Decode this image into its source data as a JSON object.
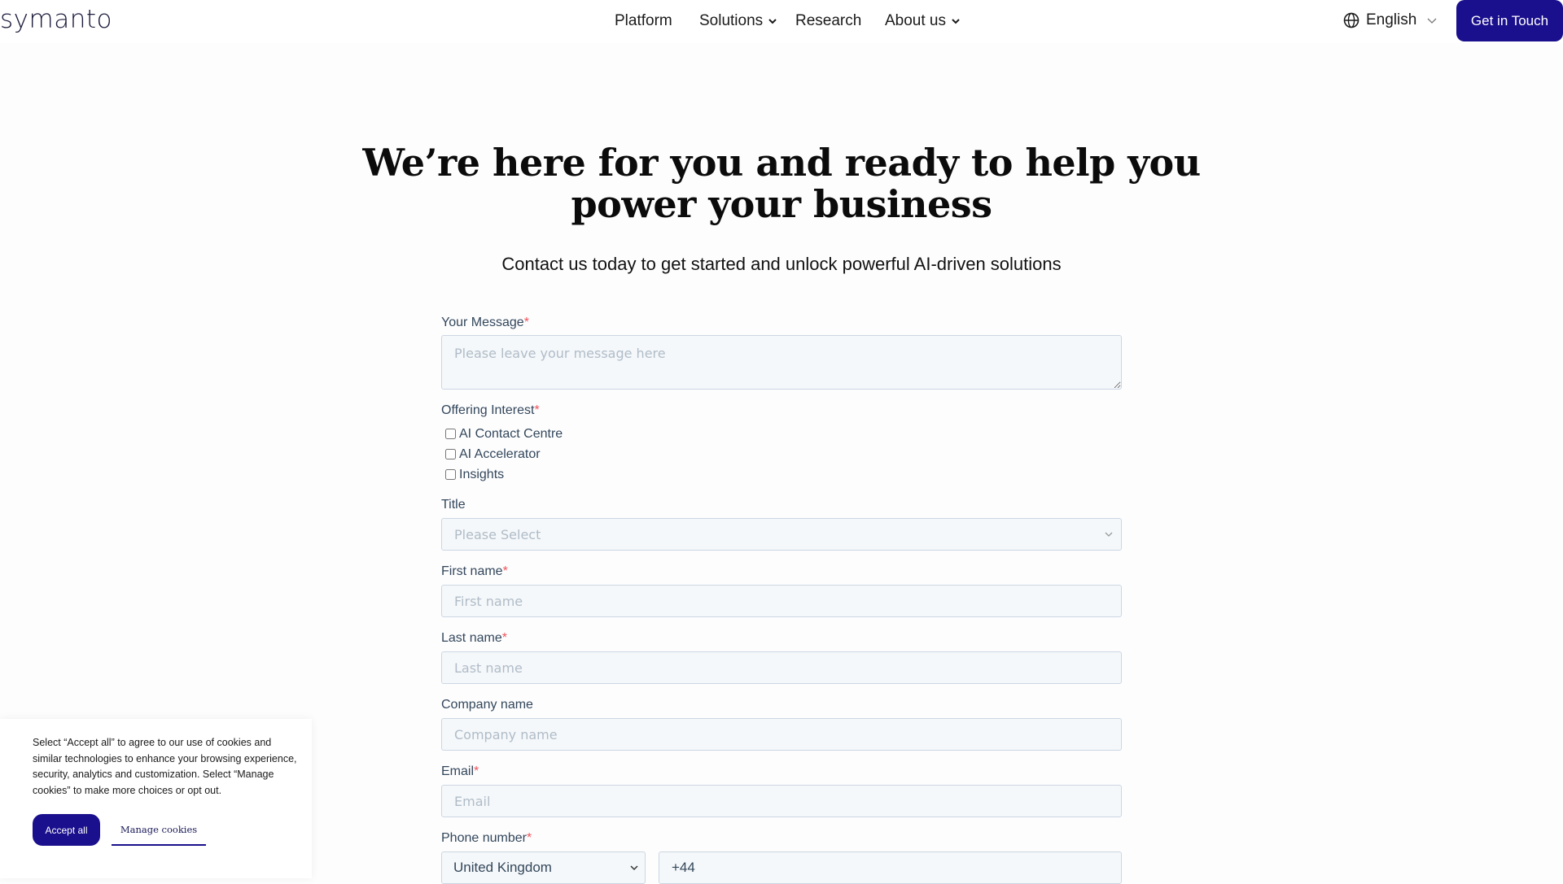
{
  "header": {
    "logo": "symanto",
    "nav": [
      {
        "label": "Platform",
        "has_dropdown": false
      },
      {
        "label": "Solutions",
        "has_dropdown": true
      },
      {
        "label": "Research",
        "has_dropdown": false
      },
      {
        "label": "About us",
        "has_dropdown": true
      }
    ],
    "language": "English",
    "cta_label": "Get in Touch"
  },
  "hero": {
    "title_line1": "We’re here for you and ready to help you",
    "title_line2": "power your business",
    "subtitle": "Contact us today to get started and unlock powerful AI-driven solutions"
  },
  "form": {
    "message": {
      "label": "Your Message",
      "required": "*",
      "placeholder": "Please leave your message here"
    },
    "offering": {
      "label": "Offering Interest",
      "required": "*",
      "options": [
        "AI Contact Centre",
        "AI Accelerator",
        "Insights"
      ]
    },
    "title": {
      "label": "Title",
      "placeholder": "Please Select"
    },
    "first_name": {
      "label": "First name",
      "required": "*",
      "placeholder": "First name"
    },
    "last_name": {
      "label": "Last name",
      "required": "*",
      "placeholder": "Last name"
    },
    "company": {
      "label": "Company name",
      "placeholder": "Company name"
    },
    "email": {
      "label": "Email",
      "required": "*",
      "placeholder": "Email"
    },
    "phone": {
      "label": "Phone number",
      "required": "*",
      "country": "United Kingdom",
      "code": "+44"
    }
  },
  "cookie": {
    "text": "Select “Accept all” to agree to our use of cookies and similar technologies to enhance your browsing experience, security, analytics and customization. Select “Manage cookies” to make more choices or opt out.",
    "accept_label": "Accept all",
    "manage_label": "Manage cookies"
  },
  "colors": {
    "brand": "#1a0f8c",
    "required": "#f2545b",
    "field_bg": "#f5f8fa",
    "field_border": "#cbd6e2"
  }
}
